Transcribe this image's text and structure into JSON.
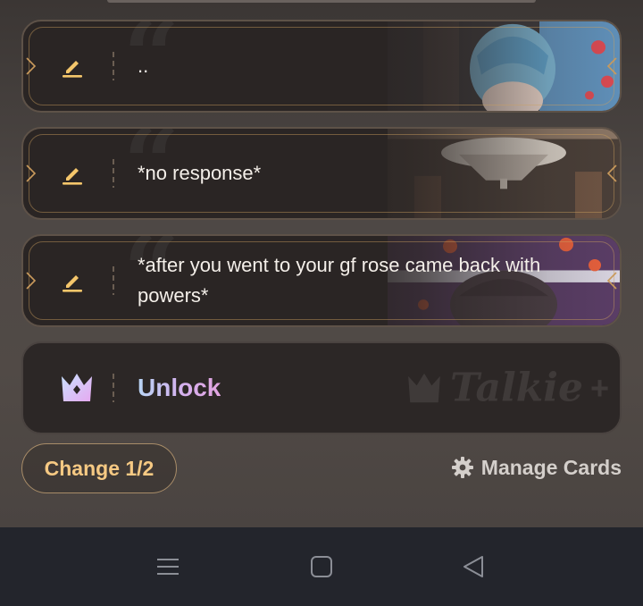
{
  "cards": [
    {
      "text": ".."
    },
    {
      "text": "*no response*"
    },
    {
      "text": "*after you went to your gf rose came back with powers*"
    }
  ],
  "unlock": {
    "label": "Unlock",
    "brand": "Talkie"
  },
  "footer": {
    "change_label": "Change 1/2",
    "manage_label": "Manage Cards"
  },
  "nav": {
    "buttons": [
      "menu-icon",
      "home-icon",
      "back-icon"
    ]
  },
  "colors": {
    "accent_gold": "#f6c983",
    "unlock_gradient_start": "#b8d4f4",
    "unlock_gradient_end": "#e2a4e0",
    "nav_background": "#23252c"
  }
}
